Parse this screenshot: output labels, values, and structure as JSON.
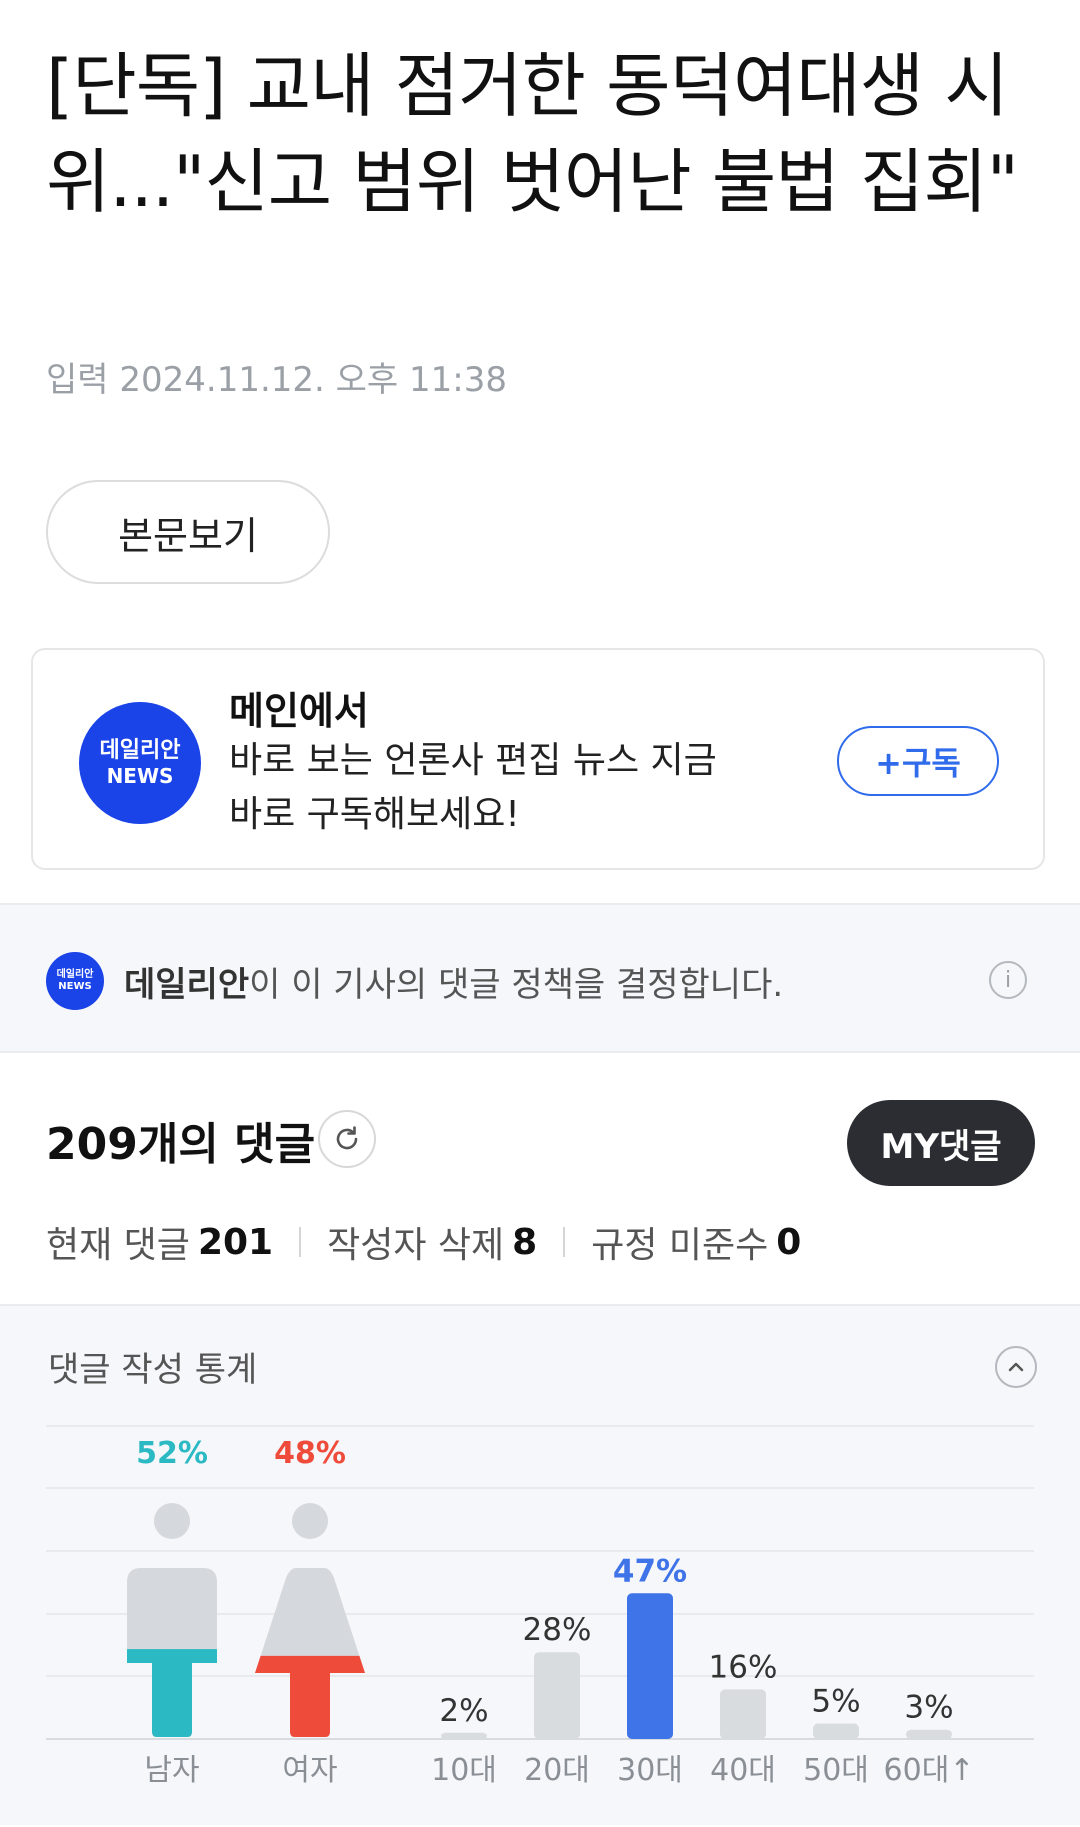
{
  "article": {
    "title": "[단독] 교내 점거한 동덕여대생 시위...\"신고 범위 벗어난 불법 집회\"",
    "byline": "입력 2024.11.12. 오후 11:38",
    "view_body_label": "본문보기"
  },
  "subscribe_card": {
    "logo_line1": "데일리안",
    "logo_line2": "NEWS",
    "title": "메인에서",
    "description": "바로 보는 언론사 편집 뉴스 지금 바로 구독해보세요!",
    "button_label": "+구독",
    "accent": "#2f6bea",
    "logo_color": "#1a43e8"
  },
  "policy": {
    "publisher": "데일리안",
    "text": "이 이 기사의 댓글 정책을 결정합니다.",
    "info_icon": "i"
  },
  "comments": {
    "count_label": "209개의 댓글",
    "my_button": "MY댓글",
    "stats": [
      {
        "label": "현재 댓글",
        "value": "201"
      },
      {
        "label": "작성자 삭제",
        "value": "8"
      },
      {
        "label": "규정 미준수",
        "value": "0"
      }
    ]
  },
  "stats_panel": {
    "title": "댓글 작성 통계"
  },
  "chart_data": {
    "type": "bar",
    "gender": {
      "categories": [
        "남자",
        "여자"
      ],
      "values": [
        52,
        48
      ],
      "labels": [
        "52%",
        "48%"
      ],
      "colors": [
        "#2bb9c3",
        "#ef4b3b"
      ]
    },
    "age": {
      "categories": [
        "10대",
        "20대",
        "30대",
        "40대",
        "50대",
        "60대↑"
      ],
      "values": [
        2,
        28,
        47,
        16,
        5,
        3
      ],
      "labels": [
        "2%",
        "28%",
        "47%",
        "16%",
        "5%",
        "3%"
      ],
      "highlight_index": 2,
      "highlight_color": "#3f73e8",
      "bar_color": "#d9dcdf"
    },
    "grid": true
  }
}
